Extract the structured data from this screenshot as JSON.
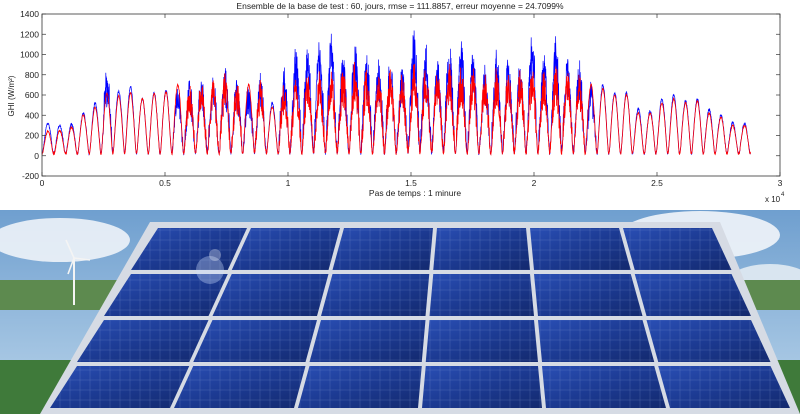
{
  "chart_data": {
    "type": "line",
    "title": "Ensemble de la base de test : 60, jours, rmse = 111.8857, erreur moyenne = 24.7099%",
    "xlabel": "Pas de temps : 1 minure",
    "ylabel": "GHI (W/m²)",
    "x_multiplier_label": "x 10",
    "x_multiplier_exp": "4",
    "xlim": [
      0,
      30000
    ],
    "ylim": [
      -200,
      1400
    ],
    "x_ticks": [
      "0",
      "0.5",
      "1",
      "1.5",
      "2",
      "2.5",
      "3"
    ],
    "x_tick_values": [
      0,
      5000,
      10000,
      15000,
      20000,
      25000,
      30000
    ],
    "y_ticks": [
      "-200",
      "0",
      "200",
      "400",
      "600",
      "800",
      "1000",
      "1200",
      "1400"
    ],
    "y_tick_values": [
      -200,
      0,
      200,
      400,
      600,
      800,
      1000,
      1200,
      1400
    ],
    "n_days": 60,
    "day_peaks_measured": [
      320,
      300,
      310,
      420,
      520,
      870,
      640,
      680,
      560,
      620,
      640,
      720,
      760,
      800,
      780,
      880,
      780,
      720,
      820,
      520,
      900,
      1120,
      1080,
      1180,
      1220,
      1000,
      1160,
      1060,
      960,
      1000,
      900,
      1260,
      1120,
      980,
      1120,
      1140,
      1050,
      900,
      1100,
      1000,
      960,
      1240,
      1030,
      1180,
      1020,
      960,
      760,
      700,
      620,
      620,
      460,
      440,
      560,
      600,
      540,
      560,
      460,
      400,
      330,
      320
    ],
    "day_peaks_predicted": [
      240,
      250,
      280,
      400,
      480,
      620,
      590,
      620,
      560,
      610,
      630,
      700,
      720,
      760,
      760,
      820,
      740,
      700,
      760,
      480,
      720,
      820,
      860,
      840,
      900,
      860,
      940,
      880,
      840,
      880,
      820,
      940,
      880,
      840,
      920,
      900,
      880,
      820,
      900,
      860,
      860,
      920,
      880,
      920,
      880,
      820,
      700,
      660,
      600,
      600,
      420,
      420,
      520,
      560,
      520,
      540,
      420,
      380,
      300,
      300
    ],
    "series": [
      {
        "name": "",
        "color": "#0000ff"
      },
      {
        "name": "",
        "color": "#ff0000"
      }
    ]
  },
  "photo": {
    "subject": "solar-panel-array",
    "sky_color": "#8fb8dc",
    "panel_color": "#1e3f9a",
    "frame_color": "#d6dbe4",
    "grass_color": "#3f7a3a"
  }
}
